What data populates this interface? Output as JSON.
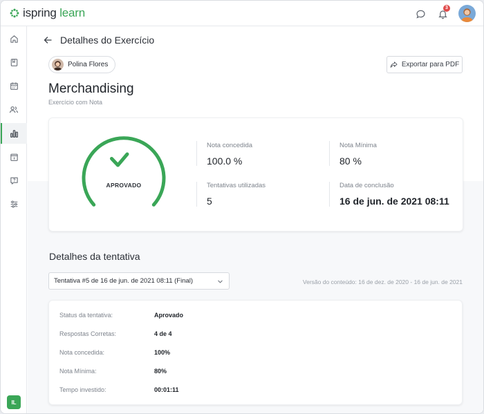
{
  "app": {
    "logo_word": "ispring",
    "logo_word_accent": "learn",
    "notifications_count": "3",
    "user_initials": "IL",
    "brand_color": "#3aa657"
  },
  "sidebar": {
    "items": [
      {
        "icon": "home-icon"
      },
      {
        "icon": "book-icon"
      },
      {
        "icon": "calendar-icon"
      },
      {
        "icon": "users-icon"
      },
      {
        "icon": "bar-chart-icon",
        "active": true
      },
      {
        "icon": "info-card-icon"
      },
      {
        "icon": "help-chat-icon"
      },
      {
        "icon": "sliders-icon"
      }
    ]
  },
  "header": {
    "title": "Detalhes do Exercício"
  },
  "learner": {
    "name": "Polina Flores"
  },
  "export_button": {
    "label": "Exportar para PDF"
  },
  "exercise": {
    "title": "Merchandising",
    "subtitle": "Exercício com Nota"
  },
  "summary": {
    "status": "APROVADO",
    "progress_fraction": 1.0,
    "stats": {
      "score_label": "Nota concedida",
      "score_value": "100.0 %",
      "min_label": "Nota Mínima",
      "min_value": "80 %",
      "attempts_label": "Tentativas utilizadas",
      "attempts_value": "5",
      "date_label": "Data de conclusão",
      "date_value": "16 de jun. de 2021 08:11"
    }
  },
  "attempt": {
    "section_title": "Detalhes da tentativa",
    "selected": "Tentativa #5 de 16 de jun. de 2021 08:11 (Final)",
    "version_note": "Versão do conteúdo: 16 de dez. de 2020 - 16 de jun. de 2021",
    "rows": [
      {
        "label": "Status da tentativa:",
        "value": "Aprovado"
      },
      {
        "label": "Respostas Corretas:",
        "value": "4 de 4"
      },
      {
        "label": "Nota concedida:",
        "value": "100%"
      },
      {
        "label": "Nota Mínima:",
        "value": "80%"
      },
      {
        "label": "Tempo investido:",
        "value": "00:01:11"
      }
    ]
  }
}
